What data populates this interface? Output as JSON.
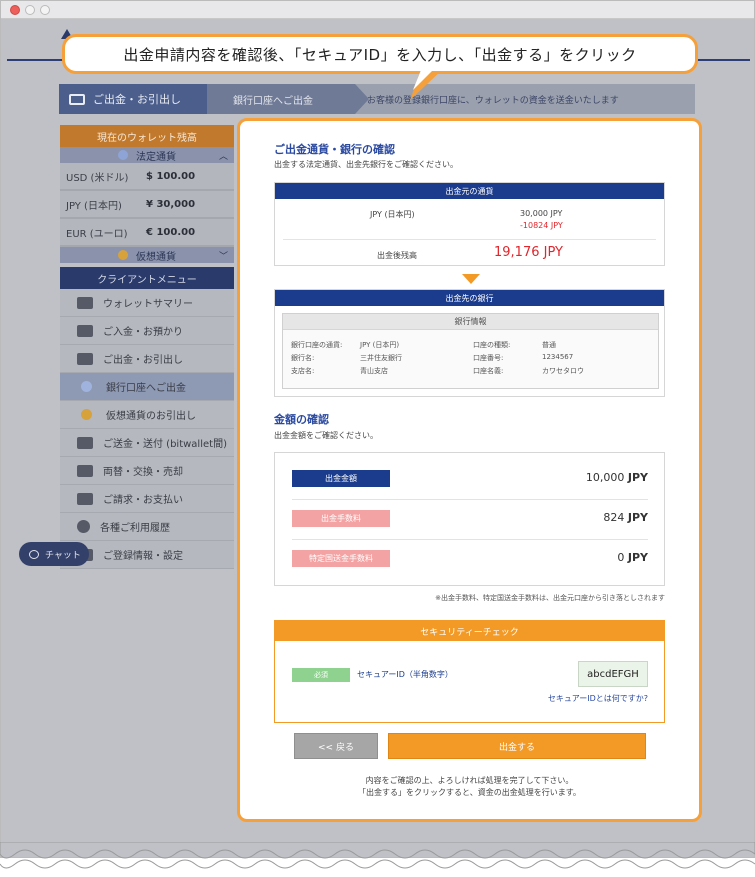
{
  "callout": {
    "text": "出金申請内容を確認後、「セキュアID」を入力し、「出金する」をクリック"
  },
  "breadcrumb": {
    "step1": "ご出金・お引出し",
    "step2": "銀行口座へご出金",
    "step3": "お客様の登録銀行口座に、ウォレットの資金を送金いたします"
  },
  "sidebar": {
    "wallet_header": "現在のウォレット残高",
    "fiat_header": "法定通貨",
    "balances": [
      {
        "currency": "USD (米ドル)",
        "amount": "$ 100.00"
      },
      {
        "currency": "JPY (日本円)",
        "amount": "¥ 30,000"
      },
      {
        "currency": "EUR (ユーロ)",
        "amount": "€ 100.00"
      }
    ],
    "crypto_header": "仮想通貨",
    "menu_header": "クライアントメニュー",
    "menu": [
      {
        "label": "ウォレットサマリー",
        "icon": "wallet-icon"
      },
      {
        "label": "ご入金・お預かり",
        "icon": "deposit-icon"
      },
      {
        "label": "ご出金・お引出し",
        "icon": "withdraw-icon"
      },
      {
        "label": "銀行口座へご出金",
        "icon": "bank-coin-icon"
      },
      {
        "label": "仮想通貨のお引出し",
        "icon": "crypto-coin-icon"
      },
      {
        "label": "ご送金・送付 (bitwallet間)",
        "icon": "transfer-icon"
      },
      {
        "label": "両替・交換・売却",
        "icon": "exchange-icon"
      },
      {
        "label": "ご請求・お支払い",
        "icon": "invoice-icon"
      },
      {
        "label": "各種ご利用履歴",
        "icon": "history-icon"
      },
      {
        "label": "ご登録情報・設定",
        "icon": "settings-icon"
      }
    ],
    "chat": "チャット"
  },
  "confirm": {
    "title": "ご出金通貨・銀行の確認",
    "subtitle": "出金する法定通貨、出金先銀行をご確認ください。",
    "source_header": "出金元の通貨",
    "source_currency": "JPY (日本円)",
    "source_balance": "30,000 JPY",
    "source_deduction": "-10824 JPY",
    "after_label": "出金後残高",
    "after_value": "19,176 JPY",
    "dest_header": "出金先の銀行",
    "bank_info_header": "銀行情報",
    "bank": {
      "currency_label": "銀行口座の通貨:",
      "currency_value": "JPY (日本円)",
      "name_label": "銀行名:",
      "name_value": "三井住友銀行",
      "branch_label": "支店名:",
      "branch_value": "青山支店",
      "type_label": "口座の種類:",
      "type_value": "普通",
      "number_label": "口座番号:",
      "number_value": "1234567",
      "holder_label": "口座名義:",
      "holder_value": "カワセタロウ"
    }
  },
  "amount": {
    "title": "金額の確認",
    "subtitle": "出金金額をご確認ください。",
    "rows": [
      {
        "label": "出金金額",
        "value": "10,000",
        "unit": "JPY"
      },
      {
        "label": "出金手数料",
        "value": "824",
        "unit": "JPY"
      },
      {
        "label": "特定国送金手数料",
        "value": "0",
        "unit": "JPY"
      }
    ],
    "note": "※出金手数料、特定国送金手数料は、出金元口座から引き落としされます"
  },
  "security": {
    "header": "セキュリティーチェック",
    "required": "必須",
    "label": "セキュアーID（半角数字）",
    "value": "abcdEFGH",
    "help_link": "セキュアーIDとは何ですか?"
  },
  "buttons": {
    "back": "<< 戻る",
    "submit": "出金する"
  },
  "footer": {
    "line1": "内容をご確認の上、よろしければ処理を完了して下さい。",
    "line2": "「出金する」をクリックすると、資金の出金処理を行います。"
  },
  "colors": {
    "accent_orange": "#f39a26",
    "navy": "#1b3c8c",
    "deduction_red": "#e0262c",
    "fee_pink": "#f3a3a3",
    "required_green": "#8fd18f"
  }
}
